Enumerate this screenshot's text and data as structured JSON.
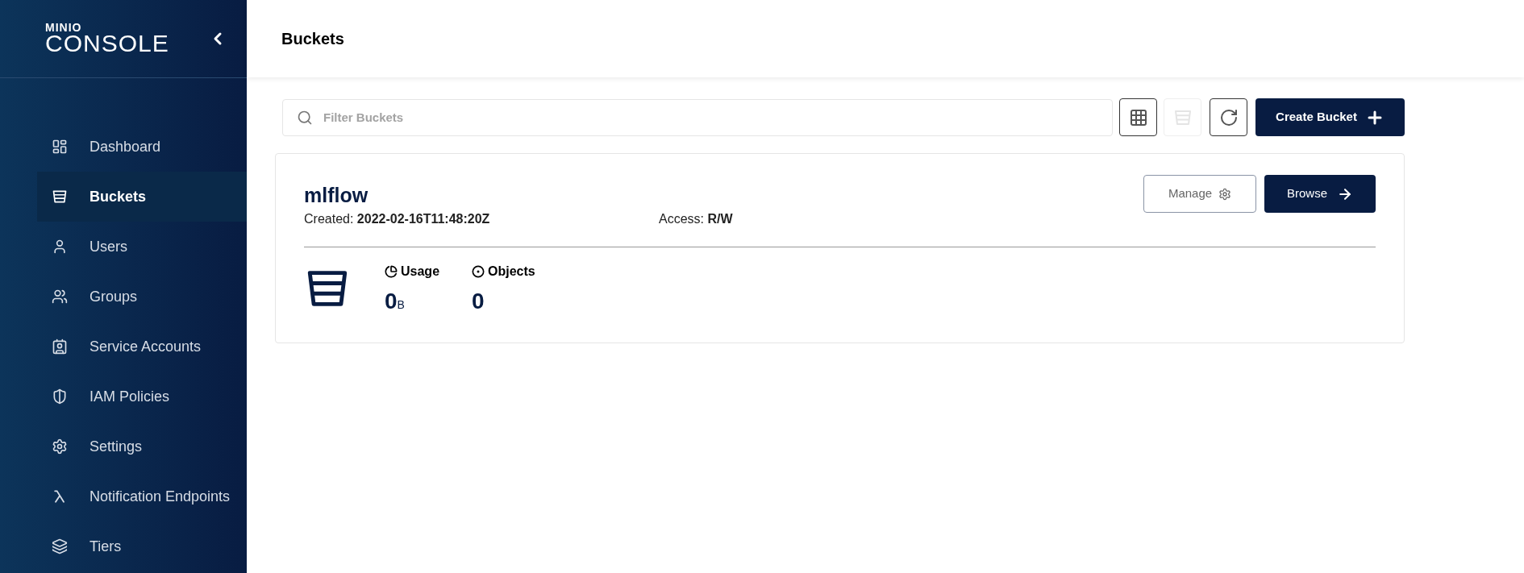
{
  "sidebar": {
    "logo": {
      "brand": "MINIO",
      "product": "CONSOLE"
    },
    "items": [
      {
        "label": "Dashboard",
        "selected": false
      },
      {
        "label": "Buckets",
        "selected": true
      },
      {
        "label": "Users",
        "selected": false
      },
      {
        "label": "Groups",
        "selected": false
      },
      {
        "label": "Service Accounts",
        "selected": false
      },
      {
        "label": "IAM Policies",
        "selected": false
      },
      {
        "label": "Settings",
        "selected": false
      },
      {
        "label": "Notification Endpoints",
        "selected": false
      },
      {
        "label": "Tiers",
        "selected": false
      }
    ]
  },
  "header": {
    "title": "Buckets"
  },
  "toolbar": {
    "search": {
      "placeholder": "Filter Buckets"
    },
    "icon_buttons": [
      {
        "disabled": false
      },
      {
        "disabled": true
      },
      {
        "disabled": false
      }
    ],
    "create_button": "Create Bucket"
  },
  "buckets": [
    {
      "name": "mlflow",
      "created_label": "Created:",
      "created": "2022-02-16T11:48:20Z",
      "access_label": "Access:",
      "access": "R/W",
      "manage_button": "Manage",
      "browse_button": "Browse",
      "usage_label": "Usage",
      "usage_value": "0",
      "usage_unit": "B",
      "objects_label": "Objects",
      "objects_value": "0"
    }
  ]
}
